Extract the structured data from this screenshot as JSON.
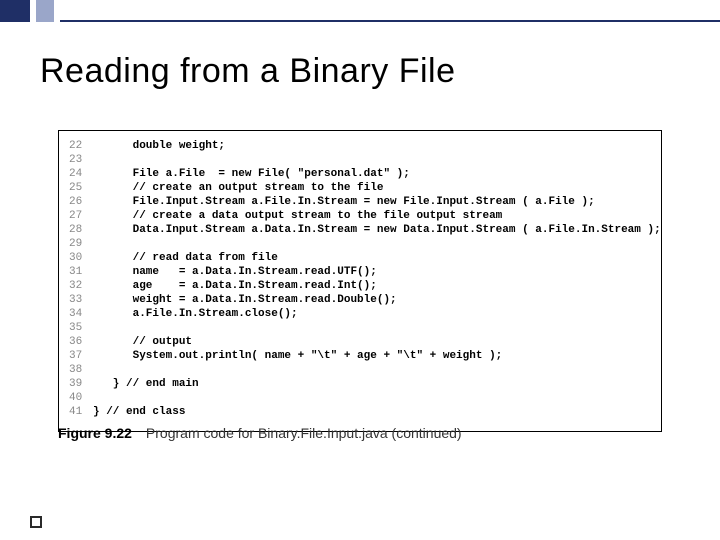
{
  "slide": {
    "title": "Reading from a Binary File"
  },
  "code": {
    "lines": [
      {
        "num": "22",
        "text": "      double weight;"
      },
      {
        "num": "23",
        "text": ""
      },
      {
        "num": "24",
        "text": "      File a.File  = new File( \"personal.dat\" );"
      },
      {
        "num": "25",
        "text": "      // create an output stream to the file"
      },
      {
        "num": "26",
        "text": "      File.Input.Stream a.File.In.Stream = new File.Input.Stream ( a.File );"
      },
      {
        "num": "27",
        "text": "      // create a data output stream to the file output stream"
      },
      {
        "num": "28",
        "text": "      Data.Input.Stream a.Data.In.Stream = new Data.Input.Stream ( a.File.In.Stream );"
      },
      {
        "num": "29",
        "text": ""
      },
      {
        "num": "30",
        "text": "      // read data from file"
      },
      {
        "num": "31",
        "text": "      name   = a.Data.In.Stream.read.UTF();"
      },
      {
        "num": "32",
        "text": "      age    = a.Data.In.Stream.read.Int();"
      },
      {
        "num": "33",
        "text": "      weight = a.Data.In.Stream.read.Double();"
      },
      {
        "num": "34",
        "text": "      a.File.In.Stream.close();"
      },
      {
        "num": "35",
        "text": ""
      },
      {
        "num": "36",
        "text": "      // output"
      },
      {
        "num": "37",
        "text": "      System.out.println( name + \"\\t\" + age + \"\\t\" + weight );"
      },
      {
        "num": "38",
        "text": ""
      },
      {
        "num": "39",
        "text": "   } // end main"
      },
      {
        "num": "40",
        "text": ""
      },
      {
        "num": "41",
        "text": "} // end class"
      }
    ]
  },
  "caption": {
    "label": "Figure 9.22",
    "text": "Program code for Binary.File.Input.java (continued)"
  }
}
